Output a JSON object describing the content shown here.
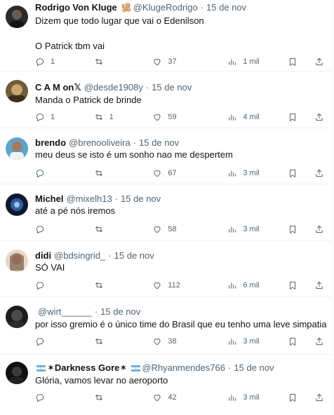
{
  "tweets": [
    {
      "name": "Rodrigo Von Kluge",
      "emoji": "🫚",
      "handle": "@KlugeRodrigo",
      "time": "15 de nov",
      "text": "Dizem que todo lugar que vai o Edenilson\n\nO Patrick tbm vai",
      "replies": "1",
      "retweets": "",
      "likes": "37",
      "views": "1 mil"
    },
    {
      "name": "C A M on𝕏",
      "handle": "@desde1908y",
      "time": "15 de nov",
      "text": "Manda o Patrick de brinde",
      "replies": "1",
      "retweets": "1",
      "likes": "59",
      "views": "4 mil"
    },
    {
      "name": "brendo",
      "handle": "@brenooliveira",
      "time": "15 de nov",
      "text": "meu deus se isto é um sonho nao me despertem",
      "replies": "",
      "retweets": "",
      "likes": "67",
      "views": "3 mil"
    },
    {
      "name": "Michel",
      "handle": "@mixelh13",
      "time": "15 de nov",
      "text": "até a pé nós iremos",
      "replies": "",
      "retweets": "",
      "likes": "58",
      "views": "3 mil"
    },
    {
      "name": "didi",
      "handle": "@bdsingrid_",
      "time": "15 de nov",
      "text": "SÓ VAI",
      "replies": "",
      "retweets": "",
      "likes": "112",
      "views": "6 mil"
    },
    {
      "name": "",
      "handle": "@wirt______",
      "time": "15 de nov",
      "text": "por isso gremio é o único time do Brasil que eu tenho uma leve simpatia",
      "replies": "",
      "retweets": "",
      "likes": "38",
      "views": "3 mil"
    },
    {
      "name": "✶Darkness Gore✶",
      "handle": "@Rhyanmendes766",
      "time": "15 de nov",
      "text": "Glória, vamos levar no aeroporto",
      "replies": "",
      "retweets": "",
      "likes": "42",
      "views": "3 mil"
    }
  ],
  "colors": {
    "text": "#0f1419",
    "secondary": "#536471",
    "divider": "#eff3f4"
  }
}
